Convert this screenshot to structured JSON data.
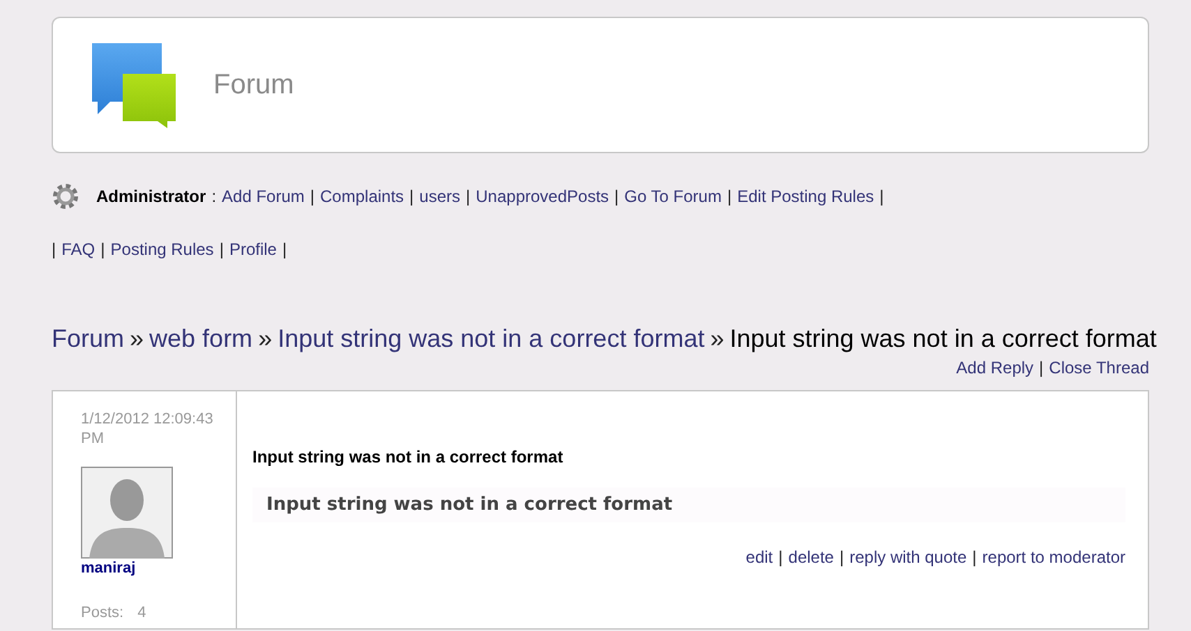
{
  "header": {
    "title": "Forum"
  },
  "admin_bar": {
    "role": "Administrator",
    "colon": ":",
    "items": [
      {
        "kind": "link",
        "text": "Add Forum"
      },
      {
        "kind": "sep",
        "text": "|"
      },
      {
        "kind": "link",
        "text": "Complaints"
      },
      {
        "kind": "sep",
        "text": "|"
      },
      {
        "kind": "link",
        "text": "users"
      },
      {
        "kind": "sep",
        "text": "|"
      },
      {
        "kind": "link",
        "text": "UnapprovedPosts"
      },
      {
        "kind": "sep",
        "text": "|"
      },
      {
        "kind": "link",
        "text": "Go To Forum"
      },
      {
        "kind": "sep",
        "text": "|"
      },
      {
        "kind": "link",
        "text": "Edit Posting Rules"
      },
      {
        "kind": "sep",
        "text": "|"
      }
    ]
  },
  "user_bar": {
    "items": [
      {
        "kind": "sep",
        "text": "|"
      },
      {
        "kind": "link",
        "text": "FAQ"
      },
      {
        "kind": "sep",
        "text": "|"
      },
      {
        "kind": "link",
        "text": "Posting Rules"
      },
      {
        "kind": "sep",
        "text": "|"
      },
      {
        "kind": "link",
        "text": "Profile"
      },
      {
        "kind": "sep",
        "text": "|"
      }
    ]
  },
  "breadcrumb": [
    {
      "kind": "link",
      "text": "Forum"
    },
    {
      "kind": "sep",
      "text": "»"
    },
    {
      "kind": "link",
      "text": "web form"
    },
    {
      "kind": "sep",
      "text": "»"
    },
    {
      "kind": "link",
      "text": "Input string was not in a correct format"
    },
    {
      "kind": "sep",
      "text": "»"
    },
    {
      "kind": "current",
      "text": "Input string was not in a correct format"
    }
  ],
  "thread_actions": [
    {
      "kind": "link",
      "text": "Add Reply"
    },
    {
      "kind": "sep",
      "text": "|"
    },
    {
      "kind": "link",
      "text": "Close Thread"
    }
  ],
  "post": {
    "date": "1/12/2012 12:09:43 PM",
    "author": "maniraj",
    "posts_label": "Posts:",
    "posts_count": "4",
    "subject": "Input string was not in a correct format",
    "body": "Input string was not in a correct format",
    "actions": [
      {
        "kind": "link",
        "text": "edit"
      },
      {
        "kind": "sep",
        "text": "|"
      },
      {
        "kind": "link",
        "text": "delete"
      },
      {
        "kind": "sep",
        "text": "|"
      },
      {
        "kind": "link",
        "text": "reply with quote"
      },
      {
        "kind": "sep",
        "text": "|"
      },
      {
        "kind": "link",
        "text": "report to moderator"
      }
    ]
  }
}
